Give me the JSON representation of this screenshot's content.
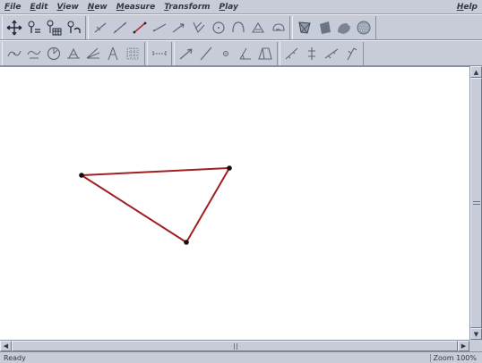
{
  "menu": {
    "items": [
      "File",
      "Edit",
      "View",
      "New",
      "Measure",
      "Transform",
      "Play"
    ],
    "help": "Help"
  },
  "toolbar1": {
    "groups": [
      [
        "move-icon",
        "point-label-icon",
        "grid-label-icon",
        "point-label-alt-icon"
      ],
      [
        "segment-icon",
        "line-icon",
        "colored-segment-icon",
        "ray-icon",
        "vector-icon",
        "perpendicular-icon",
        "circle-icon",
        "arc-icon",
        "polygon-icon",
        "sector-icon"
      ],
      [
        "fill-icon",
        "fill-shade-icon",
        "fill-pattern-icon",
        "fill-dotted-icon"
      ]
    ]
  },
  "toolbar2": {
    "groups": [
      [
        "locus-icon",
        "trace-icon",
        "rotate-icon",
        "measure-icon",
        "angle-bisector-icon",
        "compass-icon",
        "grid-icon"
      ],
      [
        "dimension-icon"
      ],
      [
        "arrow-icon",
        "slash-icon",
        "center-dot-icon",
        "angle-icon",
        "parallelogram-icon"
      ],
      [
        "reflect-icon",
        "translate-icon",
        "dilate-icon",
        "stretch-icon"
      ]
    ]
  },
  "canvas": {
    "triangle_color": "#a02020",
    "vertex_color": "#101010"
  },
  "status": {
    "text": "Ready",
    "zoom": "Zoom 100%"
  }
}
